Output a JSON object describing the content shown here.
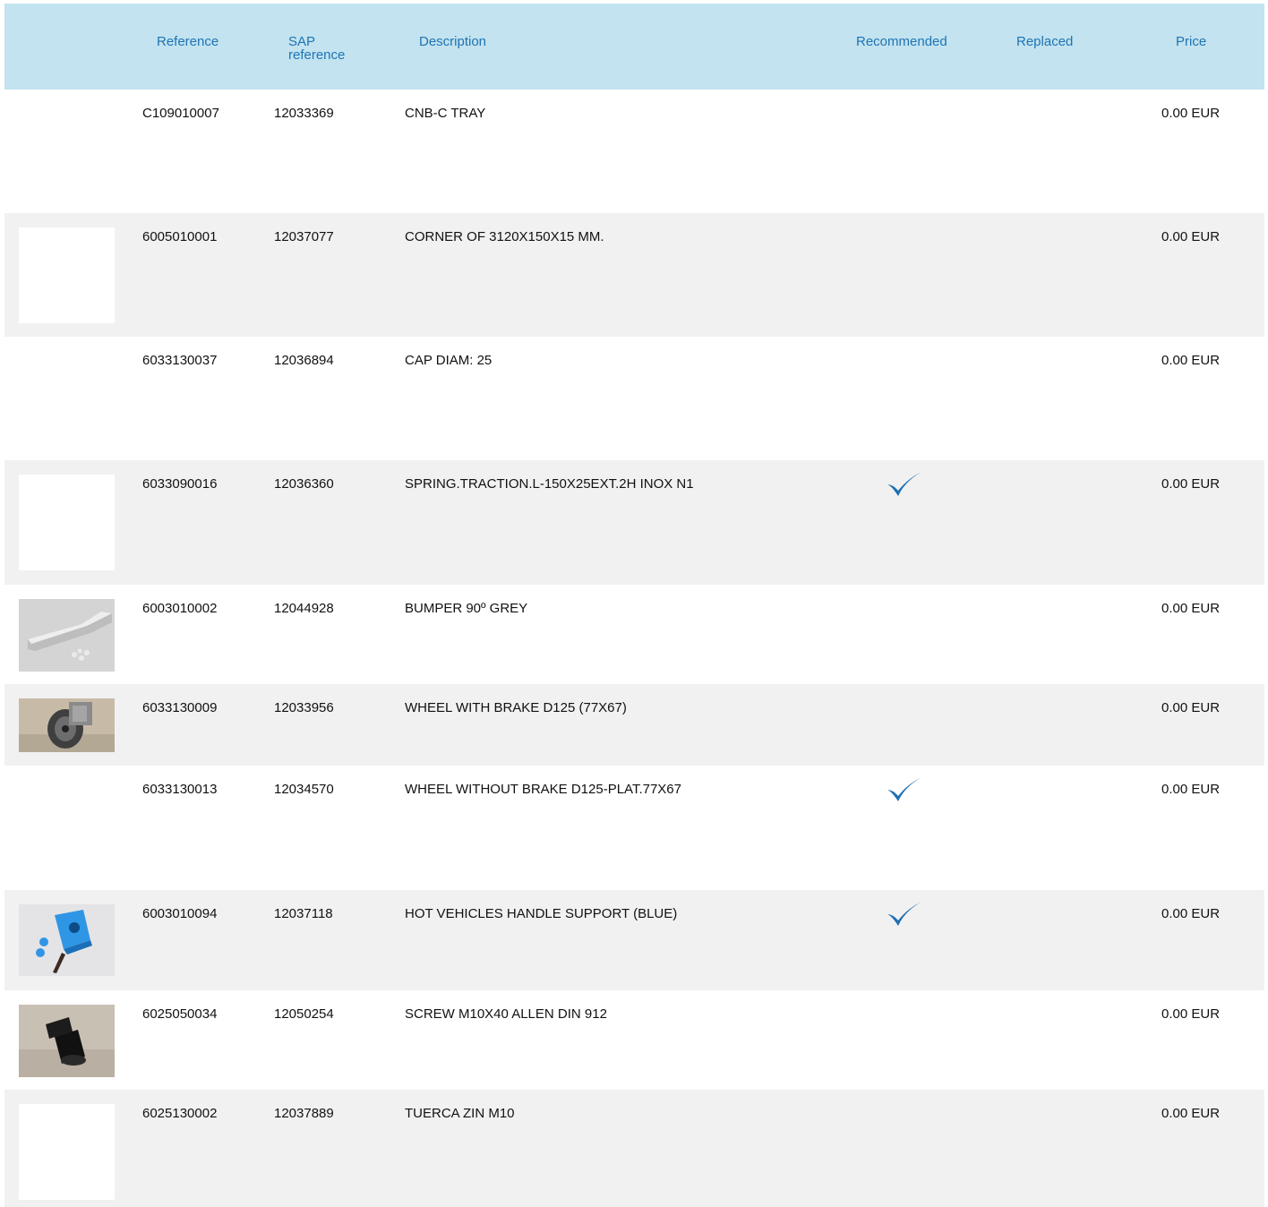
{
  "header": {
    "reference": "Reference",
    "sap_line1": "SAP",
    "sap_line2": "reference",
    "description": "Description",
    "recommended": "Recommended",
    "replaced": "Replaced",
    "price": "Price"
  },
  "rows": [
    {
      "reference": "C109010007",
      "sap": "12033369",
      "description": "CNB-C TRAY",
      "price": "0.00 EUR",
      "recommended": false,
      "image": "none"
    },
    {
      "reference": "6005010001",
      "sap": "12037077",
      "description": "CORNER OF 3120X150X15 MM.",
      "price": "0.00 EUR",
      "recommended": false,
      "image": "blank-thumbnail"
    },
    {
      "reference": "6033130037",
      "sap": "12036894",
      "description": "CAP DIAM: 25",
      "price": "0.00 EUR",
      "recommended": false,
      "image": "none"
    },
    {
      "reference": "6033090016",
      "sap": "12036360",
      "description": "SPRING.TRACTION.L-150X25EXT.2H INOX N1",
      "price": "0.00 EUR",
      "recommended": true,
      "image": "blank-thumbnail"
    },
    {
      "reference": "6003010002",
      "sap": "12044928",
      "description": "BUMPER 90º GREY",
      "price": "0.00 EUR",
      "recommended": false,
      "image": "bumper-photo"
    },
    {
      "reference": "6033130009",
      "sap": "12033956",
      "description": "WHEEL WITH BRAKE D125 (77X67)",
      "price": "0.00 EUR",
      "recommended": false,
      "image": "wheel-photo"
    },
    {
      "reference": "6033130013",
      "sap": "12034570",
      "description": "WHEEL WITHOUT BRAKE D125-PLAT.77X67",
      "price": "0.00 EUR",
      "recommended": true,
      "image": "none"
    },
    {
      "reference": "6003010094",
      "sap": "12037118",
      "description": "HOT VEHICLES HANDLE SUPPORT (BLUE)",
      "price": "0.00 EUR",
      "recommended": true,
      "image": "blue-handle-photo"
    },
    {
      "reference": "6025050034",
      "sap": "12050254",
      "description": "SCREW M10X40 ALLEN DIN 912",
      "price": "0.00 EUR",
      "recommended": false,
      "image": "screw-photo"
    },
    {
      "reference": "6025130002",
      "sap": "12037889",
      "description": "TUERCA ZIN M10",
      "price": "0.00 EUR",
      "recommended": false,
      "image": "blank-thumbnail"
    }
  ],
  "colors": {
    "header_bg": "#c2e3ef",
    "header_text": "#1f74b4",
    "row_alt_bg": "#f1f1f1",
    "check_color": "#1f6fb2"
  }
}
